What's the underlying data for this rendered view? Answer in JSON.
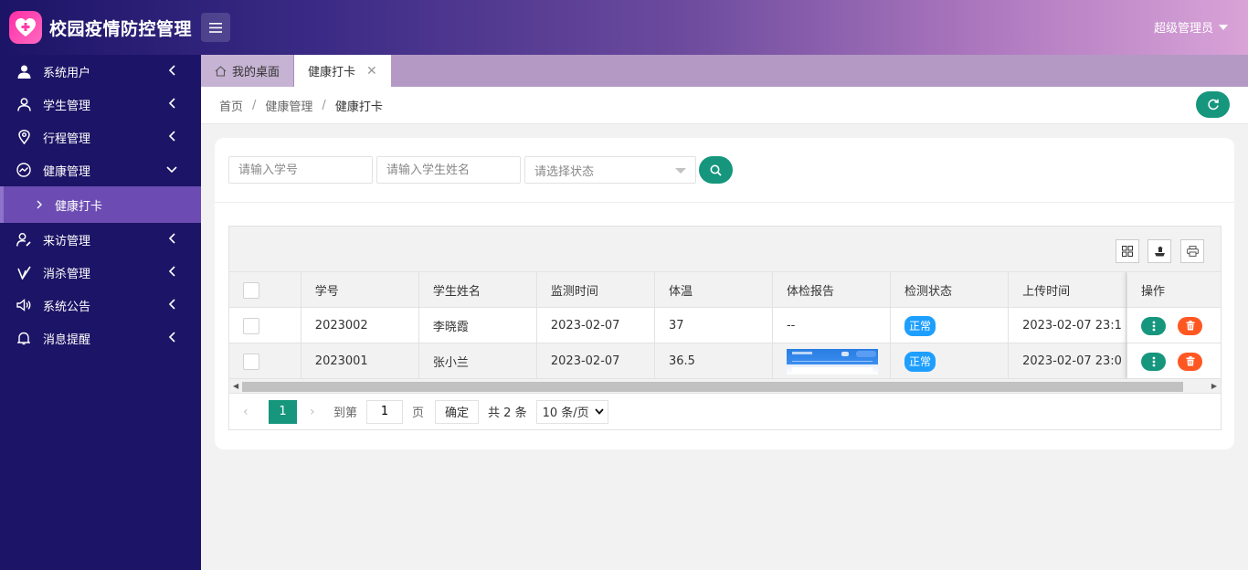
{
  "app": {
    "title": "校园疫情防控管理",
    "user": "超级管理员"
  },
  "sidebar": {
    "items": [
      {
        "label": "系统用户"
      },
      {
        "label": "学生管理"
      },
      {
        "label": "行程管理"
      },
      {
        "label": "健康管理"
      },
      {
        "label": "来访管理"
      },
      {
        "label": "消杀管理"
      },
      {
        "label": "系统公告"
      },
      {
        "label": "消息提醒"
      }
    ],
    "sub_item": "健康打卡"
  },
  "tabs": {
    "home": "我的桌面",
    "active": "健康打卡"
  },
  "breadcrumb": {
    "home": "首页",
    "section": "健康管理",
    "current": "健康打卡",
    "sep": "/"
  },
  "search": {
    "student_id_placeholder": "请输入学号",
    "student_name_placeholder": "请输入学生姓名",
    "status_placeholder": "请选择状态"
  },
  "table": {
    "columns": [
      "学号",
      "学生姓名",
      "监测时间",
      "体温",
      "体检报告",
      "检测状态",
      "上传时间",
      "操作"
    ],
    "rows": [
      {
        "student_id": "2023002",
        "name": "李晓霞",
        "date": "2023-02-07",
        "temp": "37",
        "report": "--",
        "status": "正常",
        "upload": "2023-02-07 23:1"
      },
      {
        "student_id": "2023001",
        "name": "张小兰",
        "date": "2023-02-07",
        "temp": "36.5",
        "report": "",
        "status": "正常",
        "upload": "2023-02-07 23:0"
      }
    ]
  },
  "pager": {
    "current": "1",
    "goto_label": "到第",
    "page_input": "1",
    "page_unit": "页",
    "confirm": "确定",
    "total": "共 2 条",
    "page_size": "10 条/页"
  },
  "colors": {
    "primary": "#16967d",
    "sidebar": "#1c1466",
    "sidebar_active": "#6c4cb3",
    "badge": "#1e9fff",
    "danger": "#ff5722"
  }
}
